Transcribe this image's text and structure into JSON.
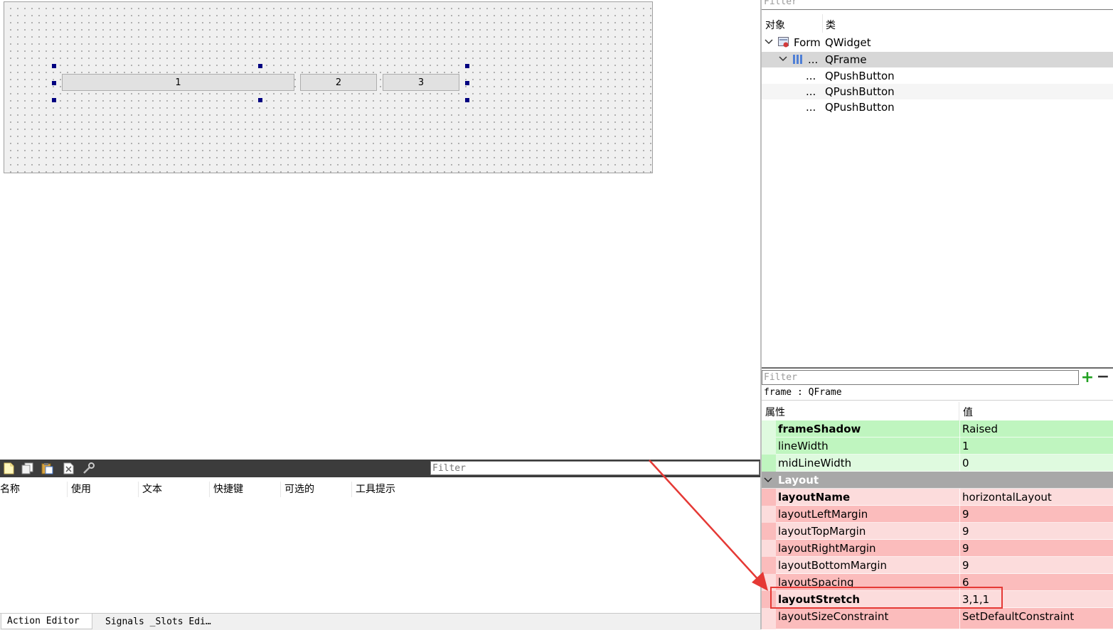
{
  "canvas": {
    "buttons": [
      "1",
      "2",
      "3"
    ]
  },
  "action_editor": {
    "toolbar_icons": [
      "new-action-icon",
      "copy-action-icon",
      "paste-action-icon",
      "delete-action-icon",
      "configure-icon"
    ],
    "filter_placeholder": "Filter",
    "columns": [
      "名称",
      "使用",
      "文本",
      "快捷键",
      "可选的",
      "工具提示"
    ],
    "tabs": [
      "Action Editor",
      "Signals _Slots Edi…"
    ]
  },
  "object_inspector": {
    "filter_placeholder": "Filter",
    "headers": {
      "object": "对象",
      "class": "类"
    },
    "tree": [
      {
        "object": "Form",
        "class": "QWidget",
        "selected": false
      },
      {
        "object": "...",
        "class": "QFrame",
        "selected": true
      },
      {
        "object": "...",
        "class": "QPushButton",
        "selected": false
      },
      {
        "object": "...",
        "class": "QPushButton",
        "selected": false
      },
      {
        "object": "...",
        "class": "QPushButton",
        "selected": false
      }
    ]
  },
  "property_editor": {
    "filter_placeholder": "Filter",
    "object_label": "frame : QFrame",
    "headers": {
      "property": "属性",
      "value": "值"
    },
    "green_rows": [
      {
        "name": "frameShadow",
        "value": "Raised",
        "bold": true
      },
      {
        "name": "lineWidth",
        "value": "1",
        "bold": false
      },
      {
        "name": "midLineWidth",
        "value": "0",
        "bold": false
      }
    ],
    "group": "Layout",
    "red_rows": [
      {
        "name": "layoutName",
        "value": "horizontalLayout",
        "bold": true
      },
      {
        "name": "layoutLeftMargin",
        "value": "9",
        "bold": false
      },
      {
        "name": "layoutTopMargin",
        "value": "9",
        "bold": false
      },
      {
        "name": "layoutRightMargin",
        "value": "9",
        "bold": false
      },
      {
        "name": "layoutBottomMargin",
        "value": "9",
        "bold": false
      },
      {
        "name": "layoutSpacing",
        "value": "6",
        "bold": false
      },
      {
        "name": "layoutStretch",
        "value": "3,1,1",
        "bold": true
      },
      {
        "name": "layoutSizeConstraint",
        "value": "SetDefaultConstraint",
        "bold": false
      }
    ]
  },
  "colors": {
    "green_dark": "#bff5bf",
    "green_light": "#dffadf",
    "red_dark": "#fbbcbc",
    "red_light": "#fcdcdc",
    "group_bg": "#a8a8a8",
    "selected_row": "#d7d7d7",
    "annotation": "#e53935"
  }
}
